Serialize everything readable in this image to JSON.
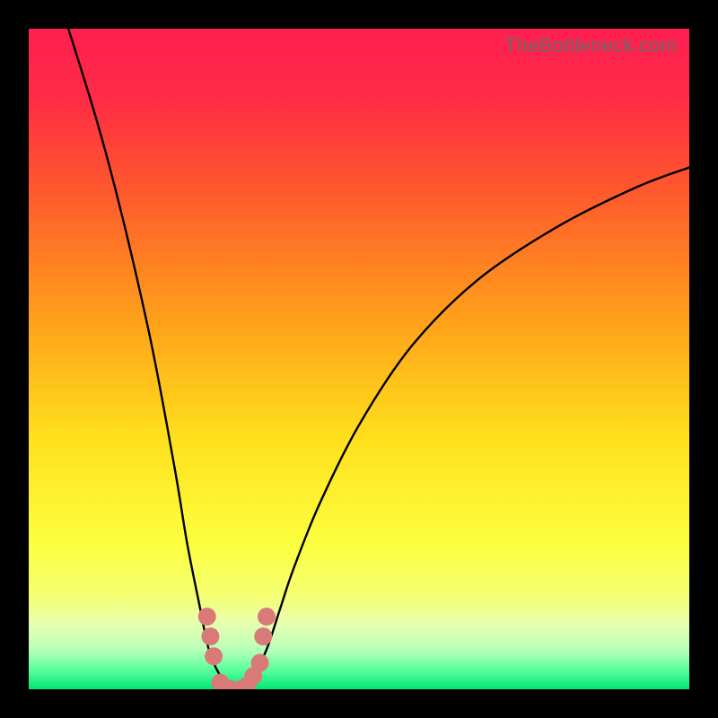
{
  "watermark": "TheBottleneck.com",
  "chart_data": {
    "type": "line",
    "title": "",
    "xlabel": "",
    "ylabel": "",
    "xlim": [
      0,
      100
    ],
    "ylim": [
      0,
      100
    ],
    "series": [
      {
        "name": "bottleneck-curve",
        "x": [
          0,
          6,
          12,
          18,
          22,
          24,
          26,
          27,
          28,
          29,
          30,
          31,
          32,
          33,
          34,
          36,
          38,
          40,
          44,
          50,
          58,
          68,
          80,
          92,
          100
        ],
        "y": [
          118,
          100,
          80,
          55,
          34,
          22,
          12,
          7,
          4,
          2,
          0,
          0,
          0,
          0.5,
          2,
          6,
          12,
          18,
          28,
          40,
          52,
          62,
          70,
          76,
          79
        ]
      }
    ],
    "markers": {
      "name": "data-points",
      "color": "#d97a79",
      "points": [
        {
          "x": 27.0,
          "y": 11
        },
        {
          "x": 27.5,
          "y": 8
        },
        {
          "x": 28.0,
          "y": 5
        },
        {
          "x": 29.0,
          "y": 1
        },
        {
          "x": 30.5,
          "y": 0
        },
        {
          "x": 32.0,
          "y": 0
        },
        {
          "x": 33.0,
          "y": 0.5
        },
        {
          "x": 34.0,
          "y": 2
        },
        {
          "x": 35.0,
          "y": 4
        },
        {
          "x": 35.5,
          "y": 8
        },
        {
          "x": 36.0,
          "y": 11
        }
      ]
    },
    "background_gradient": {
      "stops": [
        {
          "pos": 0.0,
          "color": "#ff1f50"
        },
        {
          "pos": 0.1,
          "color": "#ff2a46"
        },
        {
          "pos": 0.25,
          "color": "#ff5a2c"
        },
        {
          "pos": 0.45,
          "color": "#ffa41a"
        },
        {
          "pos": 0.62,
          "color": "#ffe01c"
        },
        {
          "pos": 0.78,
          "color": "#fcff3e"
        },
        {
          "pos": 0.86,
          "color": "#f5ff74"
        },
        {
          "pos": 0.9,
          "color": "#e7ffb0"
        },
        {
          "pos": 0.94,
          "color": "#b8ffb8"
        },
        {
          "pos": 0.97,
          "color": "#5cff9d"
        },
        {
          "pos": 1.0,
          "color": "#00e676"
        }
      ]
    }
  }
}
